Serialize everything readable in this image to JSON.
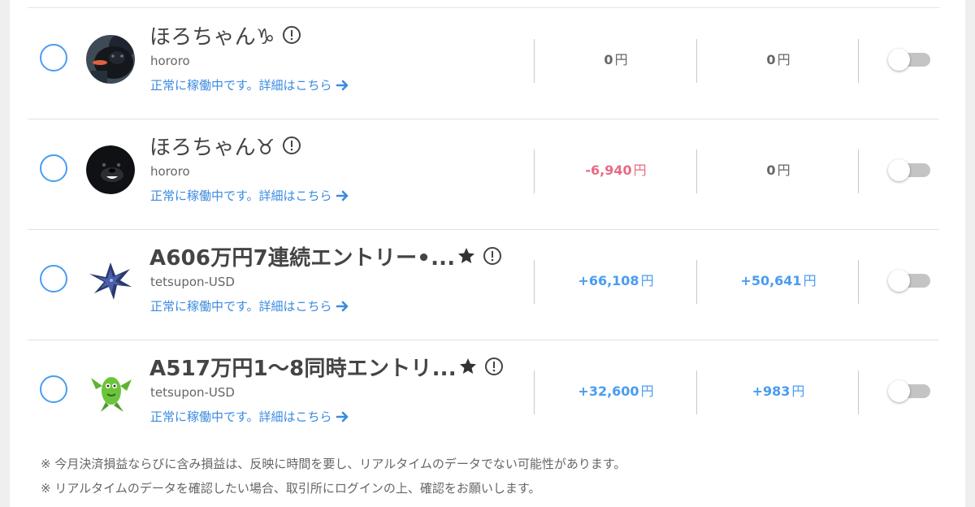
{
  "accent": "#4a9cf0",
  "negative_color": "#e86a86",
  "rows": [
    {
      "name": "ほろちゃん♑︎",
      "account": "hororo",
      "status": "正常に稼働中です。詳細はこちら",
      "value1": "0",
      "value2": "0",
      "yen": "円",
      "avatar_icon": "black-dog-avatar",
      "starred": false,
      "toggle_on": false
    },
    {
      "name": "ほろちゃん♉︎",
      "account": "hororo",
      "status": "正常に稼働中です。詳細はこちら",
      "value1": "-6,940",
      "value2": "0",
      "yen": "円",
      "avatar_icon": "black-dog-avatar",
      "starred": false,
      "toggle_on": false
    },
    {
      "name": "A606万円7連続エントリー•...",
      "account": "tetsupon-USD",
      "status": "正常に稼働中です。詳細はこちら",
      "value1": "+66,108",
      "value2": "+50,641",
      "yen": "円",
      "avatar_icon": "blue-dragon-avatar",
      "starred": true,
      "toggle_on": false
    },
    {
      "name": "A517万円1〜8同時エントリ...",
      "account": "tetsupon-USD",
      "status": "正常に稼働中です。詳細はこちら",
      "value1": "+32,600",
      "value2": "+983",
      "yen": "円",
      "avatar_icon": "green-creature-avatar",
      "starred": true,
      "toggle_on": false
    }
  ],
  "notes": [
    "※ 今月決済損益ならびに含み損益は、反映に時間を要し、リアルタイムのデータでない可能性があります。",
    "※ リアルタイムのデータを確認したい場合、取引所にログインの上、確認をお願いします。"
  ]
}
